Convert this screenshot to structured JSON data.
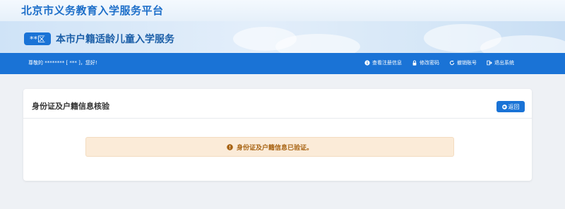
{
  "header": {
    "site_title": "北京市义务教育入学服务平台",
    "district_tag": "**区",
    "service_title": "本市户籍适龄儿童入学服务"
  },
  "nav": {
    "greeting": "尊敬的 ******** [ *** ]，您好!",
    "links": [
      {
        "label": "查看注册信息",
        "icon": "info-icon"
      },
      {
        "label": "修改密码",
        "icon": "lock-icon"
      },
      {
        "label": "撤销账号",
        "icon": "refresh-icon"
      },
      {
        "label": "退出系统",
        "icon": "logout-icon"
      }
    ]
  },
  "card": {
    "title": "身份证及户籍信息核验",
    "back_label": "返回",
    "alert_message": "身份证及户籍信息已验证。"
  },
  "colors": {
    "primary": "#1a73d6",
    "alert_bg": "#fbebd8",
    "alert_text": "#a86414"
  }
}
